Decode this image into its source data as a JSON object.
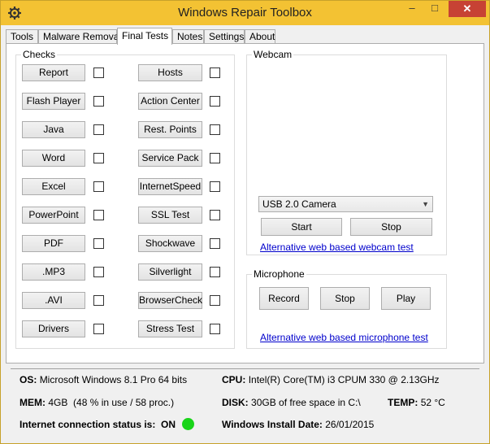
{
  "window": {
    "title": "Windows Repair Toolbox",
    "accent": "#f3c233"
  },
  "titlebar": {
    "min_glyph": "–",
    "max_glyph": "□",
    "close_glyph": "✕",
    "icon": "gear-icon"
  },
  "tabs": [
    {
      "label": "Tools"
    },
    {
      "label": "Malware Removal"
    },
    {
      "label": "Final Tests"
    },
    {
      "label": "Notes"
    },
    {
      "label": "Settings"
    },
    {
      "label": "About"
    }
  ],
  "checks": {
    "title": "Checks",
    "left": [
      "Report",
      "Flash Player",
      "Java",
      "Word",
      "Excel",
      "PowerPoint",
      "PDF",
      ".MP3",
      ".AVI",
      "Drivers"
    ],
    "right": [
      "Hosts",
      "Action Center",
      "Rest. Points",
      "Service Pack",
      "InternetSpeed",
      "SSL Test",
      "Shockwave",
      "Silverlight",
      "BrowserCheck",
      "Stress Test"
    ]
  },
  "webcam": {
    "title": "Webcam",
    "device": "USB 2.0 Camera",
    "start": "Start",
    "stop": "Stop",
    "link": "Alternative web based webcam test"
  },
  "microphone": {
    "title": "Microphone",
    "record": "Record",
    "stop": "Stop",
    "play": "Play",
    "link": "Alternative web based microphone test"
  },
  "sysinfo": {
    "os_label": "OS:",
    "os_value": "Microsoft Windows 8.1 Pro 64 bits",
    "cpu_label": "CPU:",
    "cpu_value": "Intel(R) Core(TM) i3 CPU",
    "cpu_model": "M 330  @ 2.13GHz",
    "mem_label": "MEM:",
    "mem_value": "4GB",
    "mem_detail": "(48 % in use / 58 proc.)",
    "disk_label": "DISK:",
    "disk_value": "30GB of free space in C:\\",
    "temp_label": "TEMP:",
    "temp_value": "52 °C",
    "net_label": "Internet connection status is:",
    "net_value": "ON",
    "net_color": "#19d419",
    "install_label": "Windows Install Date:",
    "install_value": "26/01/2015"
  }
}
